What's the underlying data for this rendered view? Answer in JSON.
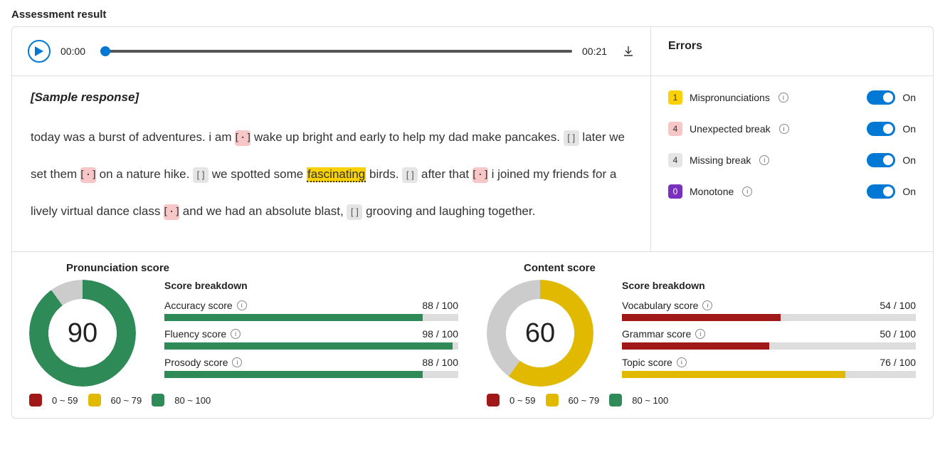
{
  "page_title": "Assessment result",
  "player": {
    "current": "00:00",
    "total": "00:21"
  },
  "errors_panel": {
    "title": "Errors",
    "items": [
      {
        "count": "1",
        "label": "Mispronunciations",
        "badge_class": "badge-yellow",
        "state": "On"
      },
      {
        "count": "4",
        "label": "Unexpected break",
        "badge_class": "badge-pink",
        "state": "On"
      },
      {
        "count": "4",
        "label": "Missing break",
        "badge_class": "badge-gray",
        "state": "On"
      },
      {
        "count": "0",
        "label": "Monotone",
        "badge_class": "badge-purple",
        "state": "On"
      }
    ]
  },
  "transcript": {
    "sample_label": "[Sample response]",
    "segments": [
      {
        "t": "text",
        "v": "today was a burst of adventures. i am "
      },
      {
        "t": "unex"
      },
      {
        "t": "text",
        "v": " wake up bright and early to help my dad make pancakes. "
      },
      {
        "t": "miss"
      },
      {
        "t": "text",
        "v": " later we set them "
      },
      {
        "t": "unex"
      },
      {
        "t": "text",
        "v": " on a nature hike. "
      },
      {
        "t": "miss"
      },
      {
        "t": "text",
        "v": " we spotted some "
      },
      {
        "t": "mispron",
        "v": "fascinating"
      },
      {
        "t": "text",
        "v": " birds. "
      },
      {
        "t": "miss"
      },
      {
        "t": "text",
        "v": " after that "
      },
      {
        "t": "unex"
      },
      {
        "t": "text",
        "v": " i joined my friends for a lively virtual dance class "
      },
      {
        "t": "unex"
      },
      {
        "t": "text",
        "v": " and we had an absolute blast, "
      },
      {
        "t": "miss"
      },
      {
        "t": "text",
        "v": " grooving and laughing together."
      }
    ]
  },
  "legend": {
    "low": "0 ~ 59",
    "mid": "60 ~ 79",
    "high": "80 ~ 100"
  },
  "scores": [
    {
      "title": "Pronunciation score",
      "value": 90,
      "color": "green",
      "breakdown_title": "Score breakdown",
      "breakdown": [
        {
          "label": "Accuracy score",
          "value": 88,
          "max": 100,
          "color": "green"
        },
        {
          "label": "Fluency score",
          "value": 98,
          "max": 100,
          "color": "green"
        },
        {
          "label": "Prosody score",
          "value": 88,
          "max": 100,
          "color": "green"
        }
      ]
    },
    {
      "title": "Content score",
      "value": 60,
      "color": "yellow",
      "breakdown_title": "Score breakdown",
      "breakdown": [
        {
          "label": "Vocabulary score",
          "value": 54,
          "max": 100,
          "color": "red"
        },
        {
          "label": "Grammar score",
          "value": 50,
          "max": 100,
          "color": "red"
        },
        {
          "label": "Topic score",
          "value": 76,
          "max": 100,
          "color": "yellow"
        }
      ]
    }
  ],
  "chart_data": [
    {
      "type": "pie",
      "title": "Pronunciation score",
      "value": 90,
      "max": 100,
      "color": "#2e8b57"
    },
    {
      "type": "pie",
      "title": "Content score",
      "value": 60,
      "max": 100,
      "color": "#e0b900"
    },
    {
      "type": "bar",
      "title": "Pronunciation breakdown",
      "categories": [
        "Accuracy score",
        "Fluency score",
        "Prosody score"
      ],
      "values": [
        88,
        98,
        88
      ],
      "ylim": [
        0,
        100
      ]
    },
    {
      "type": "bar",
      "title": "Content breakdown",
      "categories": [
        "Vocabulary score",
        "Grammar score",
        "Topic score"
      ],
      "values": [
        54,
        50,
        76
      ],
      "ylim": [
        0,
        100
      ]
    }
  ]
}
